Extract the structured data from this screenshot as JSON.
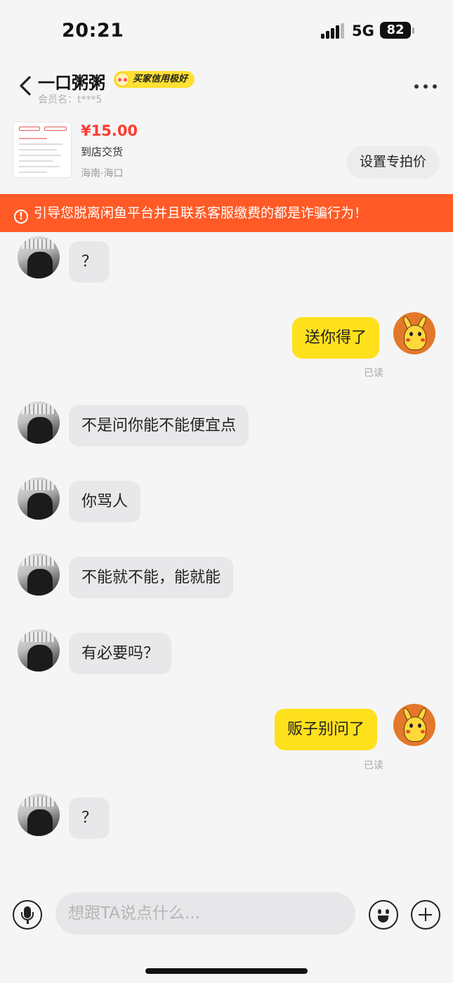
{
  "status_bar": {
    "time": "20:21",
    "network": "5G",
    "battery": "82"
  },
  "header": {
    "title": "一口粥粥",
    "credit_badge": "买家信用极好",
    "member_label": "会员名：t***5"
  },
  "product": {
    "price": "¥15.00",
    "delivery": "到店交货",
    "location": "海南·海口",
    "special_price_button": "设置专拍价"
  },
  "warning": {
    "text": "引导您脱离闲鱼平台并且联系客服缴费的都是诈骗行为！",
    "icon": "!"
  },
  "messages": [
    {
      "side": "left",
      "text": "？"
    },
    {
      "side": "right",
      "text": "送你得了",
      "status": "已读"
    },
    {
      "side": "left",
      "text": "不是问你能不能便宜点"
    },
    {
      "side": "left",
      "text": "你骂人"
    },
    {
      "side": "left",
      "text": "不能就不能，能就能"
    },
    {
      "side": "left",
      "text": "有必要吗？"
    },
    {
      "side": "right",
      "text": "贩子别问了",
      "status": "已读"
    },
    {
      "side": "left",
      "text": "？"
    }
  ],
  "input": {
    "placeholder": "想跟TA说点什么..."
  },
  "icons": {
    "back": "chevron-left-icon",
    "more": "more-dots-icon",
    "mic": "microphone-icon",
    "emoji": "emoji-icon",
    "plus": "plus-icon",
    "warning": "warning-circle-icon"
  },
  "colors": {
    "accent_yellow": "#ffe01c",
    "warning_orange": "#ff5a26",
    "price_red": "#ff3b30"
  }
}
